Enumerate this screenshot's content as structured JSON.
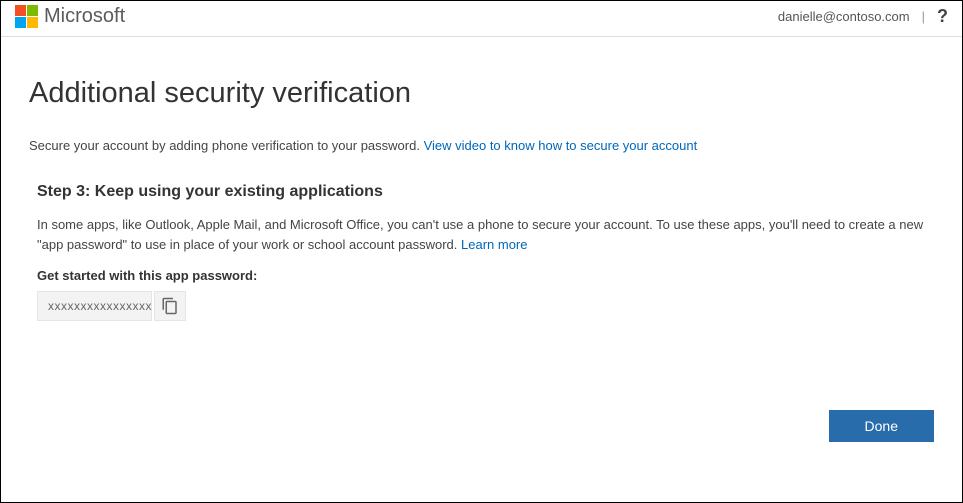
{
  "header": {
    "brand": "Microsoft",
    "user_email": "danielle@contoso.com",
    "help_label": "?"
  },
  "page": {
    "title": "Additional security verification",
    "subtext_prefix": "Secure your account by adding phone verification to your password. ",
    "subtext_link": "View video to know how to secure your account"
  },
  "step": {
    "title": "Step 3: Keep using your existing applications",
    "desc_prefix": "In some apps, like Outlook, Apple Mail, and Microsoft Office, you can't use a phone to secure your account. To use these apps, you'll need to create a new \"app password\" to use in place of your work or school account password. ",
    "desc_link": "Learn more",
    "pw_label": "Get started with this app password:",
    "pw_value": "xxxxxxxxxxxxxxxx"
  },
  "actions": {
    "done_label": "Done"
  }
}
